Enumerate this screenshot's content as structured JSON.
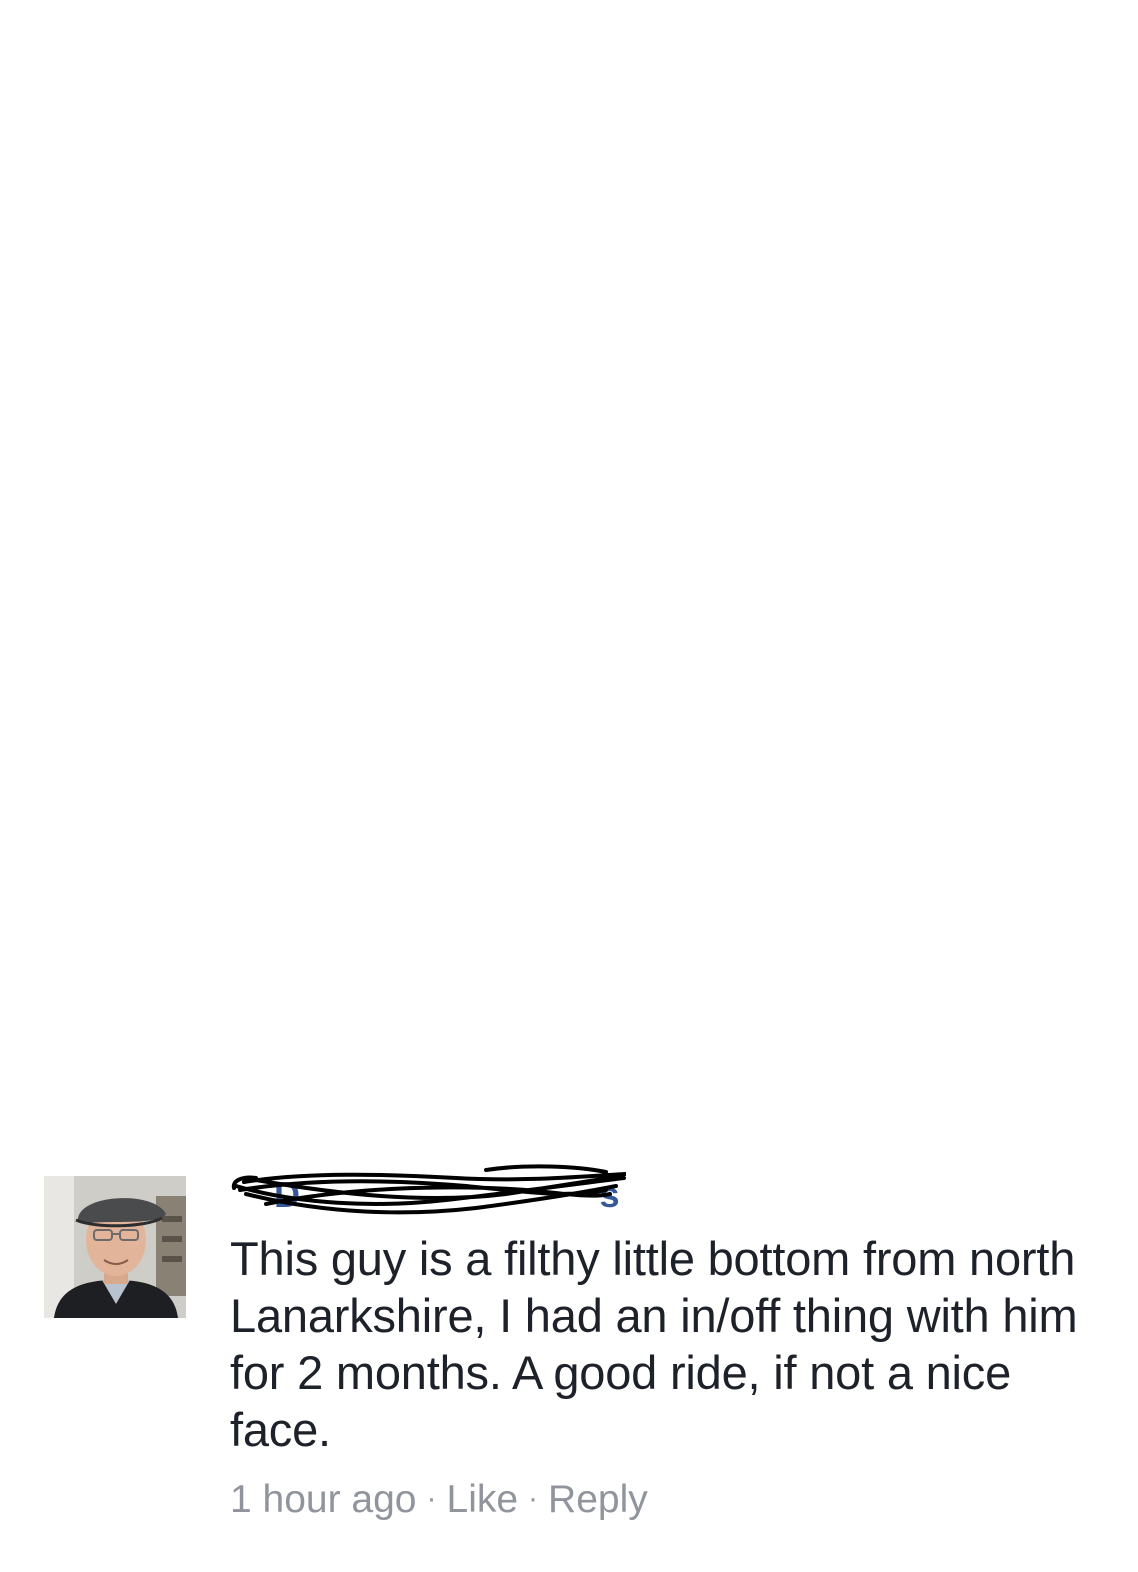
{
  "comment": {
    "author_name": "D",
    "author_name_visible_tail": "s",
    "text": "This guy is a filthy little bottom from north Lanarkshire, I had an in/off thing with him for 2 months. A good ride, if not a nice face.",
    "timestamp": "1 hour ago",
    "separator": "·",
    "like_label": "Like",
    "reply_label": "Reply"
  },
  "colors": {
    "text": "#1d2129",
    "meta": "#90949c",
    "scribble": "#000000"
  },
  "icons": {
    "avatar": "profile-photo-man-in-flat-cap"
  }
}
